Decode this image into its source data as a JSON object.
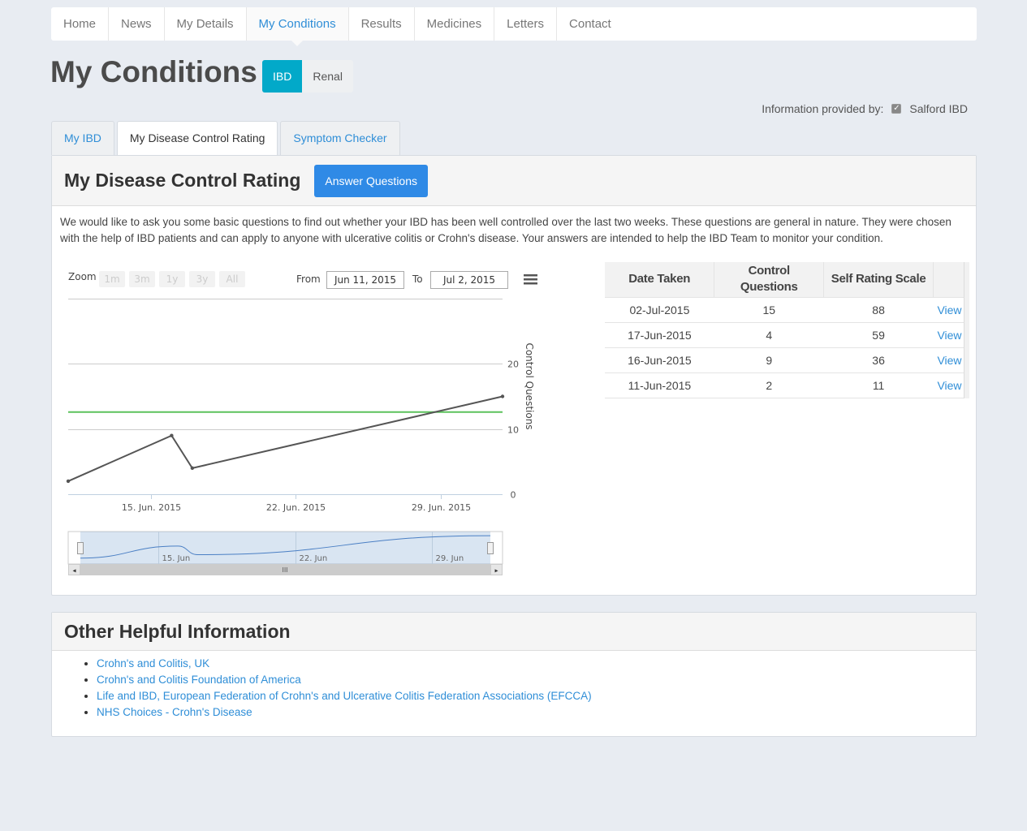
{
  "nav": {
    "items": [
      "Home",
      "News",
      "My Details",
      "My Conditions",
      "Results",
      "Medicines",
      "Letters",
      "Contact"
    ],
    "active": "My Conditions"
  },
  "page": {
    "title": "My Conditions",
    "condition_buttons": [
      "IBD",
      "Renal"
    ],
    "active_condition": "IBD",
    "info_label": "Information provided by:",
    "info_source": "Salford IBD"
  },
  "tabs": [
    "My IBD",
    "My Disease Control Rating",
    "Symptom Checker"
  ],
  "active_tab": "My Disease Control Rating",
  "rating": {
    "heading": "My Disease Control Rating",
    "answer_button": "Answer Questions",
    "intro": "We would like to ask you some basic questions to find out whether your IBD has been well controlled over the last two weeks. These questions are general in nature. They were chosen with the help of IBD patients and can apply to anyone with ulcerative colitis or Crohn's disease. Your answers are intended to help the IBD Team to monitor your condition."
  },
  "chart_controls": {
    "zoom_label": "Zoom",
    "zoom_buttons": [
      "1m",
      "3m",
      "1y",
      "3y",
      "All"
    ],
    "from_label": "From",
    "from_value": "Jun 11, 2015",
    "to_label": "To",
    "to_value": "Jul 2, 2015"
  },
  "chart_data": {
    "type": "line",
    "title": "",
    "ylabel": "Control Questions",
    "y_ticks": [
      0,
      10,
      20
    ],
    "ylim": [
      0,
      30
    ],
    "x_tick_labels": [
      "15. Jun. 2015",
      "22. Jun. 2015",
      "29. Jun. 2015"
    ],
    "x_tick_dates": [
      "2015-06-15",
      "2015-06-22",
      "2015-06-29"
    ],
    "xlim": [
      "2015-06-11",
      "2015-07-02"
    ],
    "threshold": 12.6,
    "threshold_color": "#5cc25c",
    "line_color": "#555555",
    "series": [
      {
        "x": [
          "2015-06-11",
          "2015-06-16",
          "2015-06-17",
          "2015-07-02"
        ],
        "values": [
          2,
          9,
          4,
          15
        ]
      }
    ],
    "navigator_labels": [
      "15. Jun",
      "22. Jun",
      "29. Jun"
    ]
  },
  "table": {
    "headers": [
      "Date Taken",
      "Control Questions",
      "Self Rating Scale",
      ""
    ],
    "rows": [
      {
        "date": "02-Jul-2015",
        "control": "15",
        "rating": "88",
        "action": "View"
      },
      {
        "date": "17-Jun-2015",
        "control": "4",
        "rating": "59",
        "action": "View"
      },
      {
        "date": "16-Jun-2015",
        "control": "9",
        "rating": "36",
        "action": "View"
      },
      {
        "date": "11-Jun-2015",
        "control": "2",
        "rating": "11",
        "action": "View"
      }
    ]
  },
  "other_info": {
    "heading": "Other Helpful Information",
    "links": [
      "Crohn's and Colitis, UK",
      "Crohn's and Colitis Foundation of America",
      "Life and IBD, European Federation of Crohn's and Ulcerative Colitis Federation Associations (EFCCA)",
      "NHS Choices - Crohn's Disease"
    ]
  }
}
